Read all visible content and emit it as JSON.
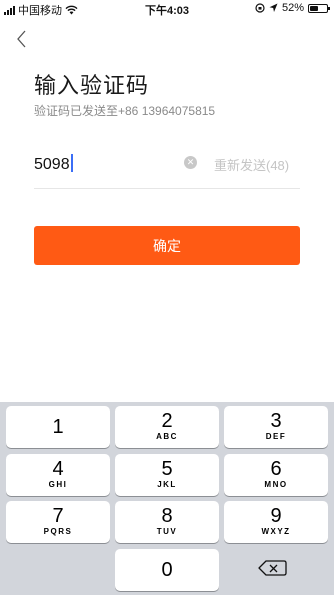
{
  "status_bar": {
    "carrier": "中国移动",
    "time": "下午4:03",
    "battery_percent": "52%",
    "battery_level": 0.52
  },
  "page": {
    "title": "输入验证码",
    "subtitle": "验证码已发送至+86 13964075815"
  },
  "code_input": {
    "value": "5098",
    "resend_label": "重新发送(48)"
  },
  "confirm_button": {
    "label": "确定"
  },
  "keyboard": {
    "keys": [
      {
        "number": "1",
        "letters": ""
      },
      {
        "number": "2",
        "letters": "ABC"
      },
      {
        "number": "3",
        "letters": "DEF"
      },
      {
        "number": "4",
        "letters": "GHI"
      },
      {
        "number": "5",
        "letters": "JKL"
      },
      {
        "number": "6",
        "letters": "MNO"
      },
      {
        "number": "7",
        "letters": "PQRS"
      },
      {
        "number": "8",
        "letters": "TUV"
      },
      {
        "number": "9",
        "letters": "WXYZ"
      },
      {
        "number": "0",
        "letters": ""
      }
    ]
  },
  "colors": {
    "accent": "#ff5a14",
    "caret": "#3b6ef6"
  }
}
